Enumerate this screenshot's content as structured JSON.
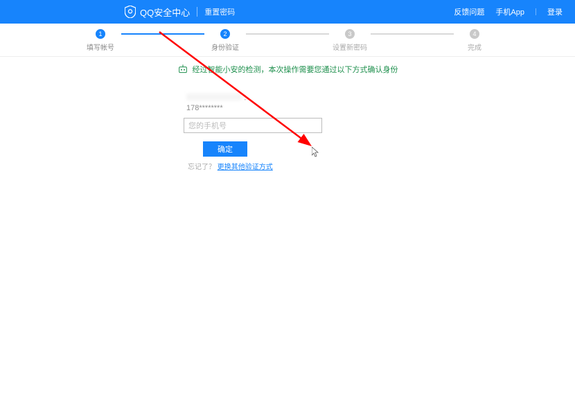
{
  "header": {
    "logo_text": "QQ安全中心",
    "subtitle": "重置密码",
    "nav_feedback": "反馈问题",
    "nav_app": "手机App",
    "nav_login": "登录"
  },
  "steps": {
    "s1": {
      "num": "1",
      "label": "填写帐号"
    },
    "s2": {
      "num": "2",
      "label": "身份验证"
    },
    "s3": {
      "num": "3",
      "label": "设置新密码"
    },
    "s4": {
      "num": "4",
      "label": "完成"
    }
  },
  "info": {
    "text": "经过智能小安的检测，本次操作需要您通过以下方式确认身份"
  },
  "form": {
    "label_suffix": "：",
    "masked_phone": "178********",
    "input_placeholder": "您的手机号",
    "confirm_label": "确定",
    "bottom_grey": "忘记了？",
    "bottom_link": "更换其他验证方式"
  }
}
